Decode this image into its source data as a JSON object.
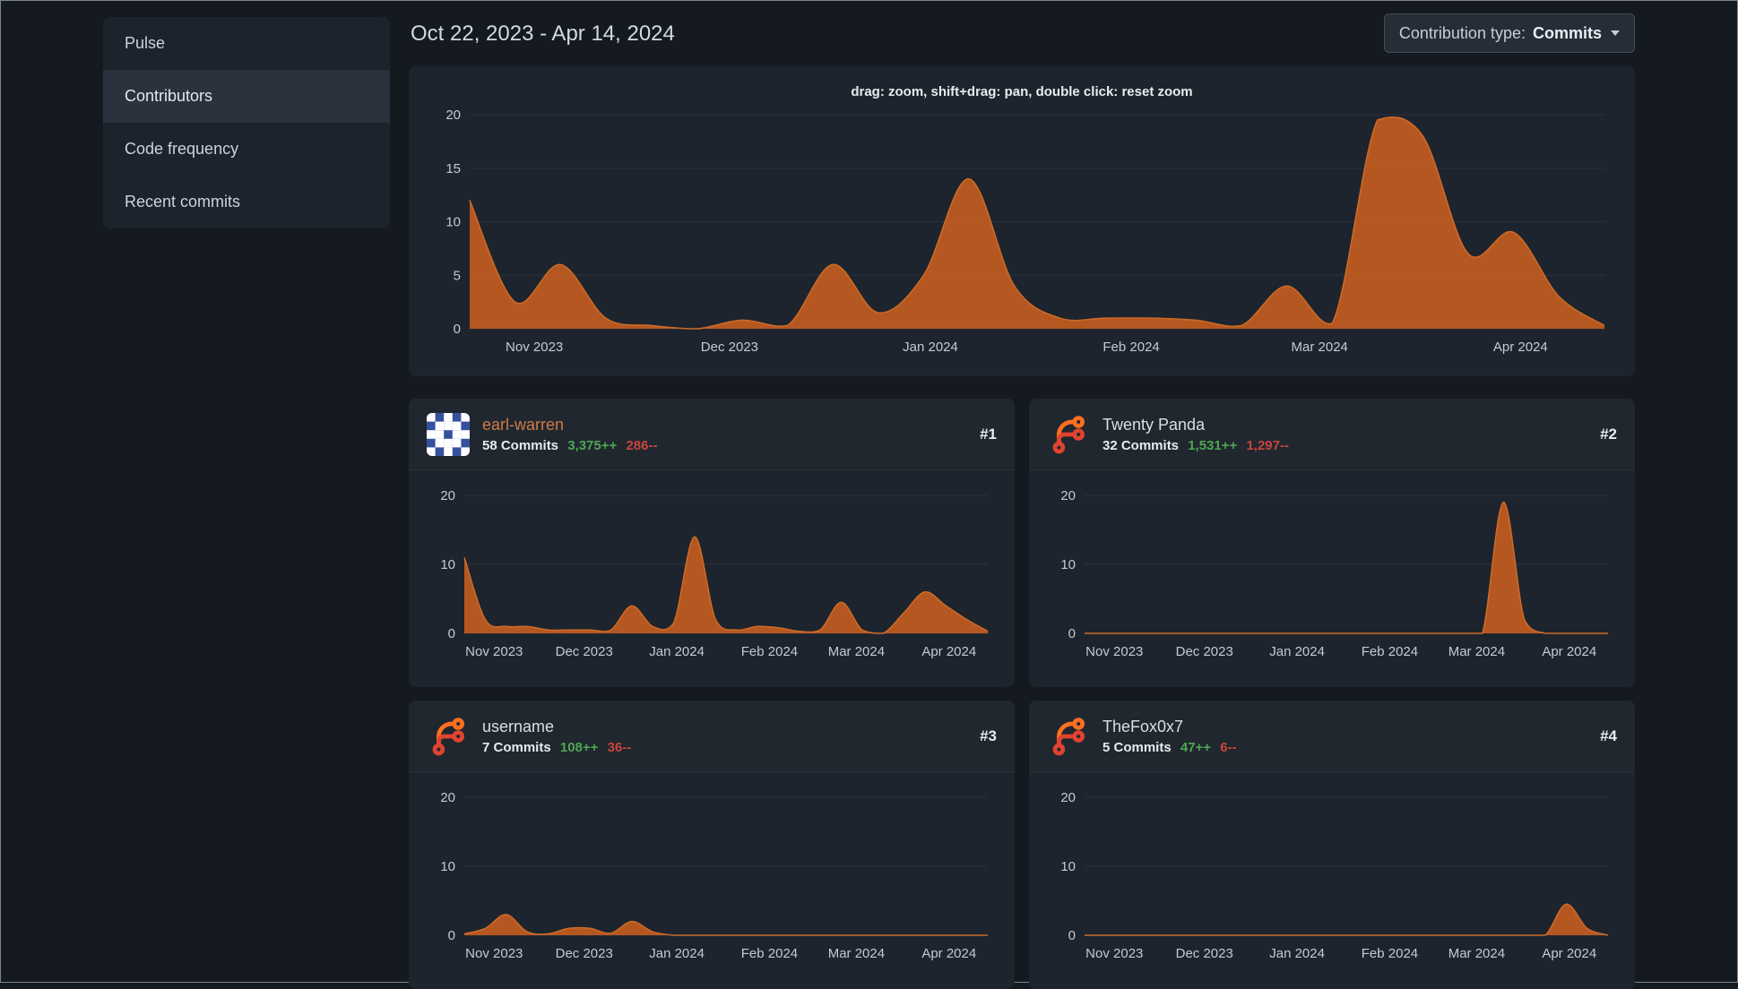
{
  "page": {
    "date_range": "Oct 22, 2023 - Apr 14, 2024"
  },
  "sidebar": {
    "items": [
      {
        "label": "Pulse",
        "active": false
      },
      {
        "label": "Contributors",
        "active": true
      },
      {
        "label": "Code frequency",
        "active": false
      },
      {
        "label": "Recent commits",
        "active": false
      }
    ]
  },
  "toolbar": {
    "contribution_type_label": "Contribution type:",
    "contribution_type_value": "Commits",
    "chevron_icon": "chevron-down-icon"
  },
  "main_chart": {
    "hint": "drag: zoom, shift+drag: pan, double click: reset zoom"
  },
  "contributors": [
    {
      "rank": "#1",
      "name": "earl-warren",
      "commits": "58 Commits",
      "additions": "3,375++",
      "deletions": "286--",
      "avatar": "identicon"
    },
    {
      "rank": "#2",
      "name": "Twenty Panda",
      "commits": "32 Commits",
      "additions": "1,531++",
      "deletions": "1,297--",
      "avatar": "forgejo-logo"
    },
    {
      "rank": "#3",
      "name": "username",
      "commits": "7 Commits",
      "additions": "108++",
      "deletions": "36--",
      "avatar": "forgejo-logo"
    },
    {
      "rank": "#4",
      "name": "TheFox0x7",
      "commits": "5 Commits",
      "additions": "47++",
      "deletions": "6--",
      "avatar": "forgejo-logo"
    }
  ],
  "chart_data": {
    "type": "area",
    "x_axis": {
      "range": [
        "Oct 22, 2023",
        "Apr 14, 2024"
      ],
      "unit": "week",
      "ticks": [
        {
          "frac": 0.057,
          "label": "Nov 2023"
        },
        {
          "frac": 0.229,
          "label": "Dec 2023"
        },
        {
          "frac": 0.406,
          "label": "Jan 2024"
        },
        {
          "frac": 0.583,
          "label": "Feb 2024"
        },
        {
          "frac": 0.749,
          "label": "Mar 2024"
        },
        {
          "frac": 0.926,
          "label": "Apr 2024"
        }
      ]
    },
    "area_color": "#bb5a20",
    "line_color": "#cf6c28",
    "grid_color": "#2b323c",
    "axis_label_color": "#c3cad3",
    "charts": [
      {
        "name": "all-contributions-commits-per-week",
        "ylim": [
          0,
          20
        ],
        "yticks": [
          0,
          5,
          10,
          15,
          20
        ],
        "values": [
          12,
          2.5,
          6,
          1,
          0.3,
          0,
          0.8,
          0.3,
          6,
          1.5,
          5,
          14,
          4,
          1,
          1,
          1,
          0.8,
          0.3,
          4,
          0.5,
          19.5,
          18,
          7,
          9,
          3,
          0.3
        ]
      },
      {
        "name": "earl-warren-commits-per-week",
        "ylim": [
          0,
          20
        ],
        "yticks": [
          0,
          10,
          20
        ],
        "values": [
          11,
          2,
          1,
          1,
          0.5,
          0.5,
          0.5,
          0.5,
          4,
          1,
          1.5,
          14,
          2,
          0.5,
          1,
          0.8,
          0.3,
          0.5,
          4.5,
          0.5,
          0,
          3,
          6,
          4,
          2,
          0.3
        ]
      },
      {
        "name": "twenty-panda-commits-per-week",
        "ylim": [
          0,
          20
        ],
        "yticks": [
          0,
          10,
          20
        ],
        "values": [
          0,
          0,
          0,
          0,
          0,
          0,
          0,
          0,
          0,
          0,
          0,
          0,
          0,
          0,
          0,
          0,
          0,
          0,
          0,
          0,
          19,
          2,
          0,
          0,
          0,
          0
        ]
      },
      {
        "name": "username-commits-per-week",
        "ylim": [
          0,
          20
        ],
        "yticks": [
          0,
          10,
          20
        ],
        "values": [
          0.2,
          1,
          3,
          0.5,
          0.2,
          1,
          1,
          0.3,
          2,
          0.5,
          0,
          0,
          0,
          0,
          0,
          0,
          0,
          0,
          0,
          0,
          0,
          0,
          0,
          0,
          0,
          0
        ]
      },
      {
        "name": "thefox0x7-commits-per-week",
        "ylim": [
          0,
          20
        ],
        "yticks": [
          0,
          10,
          20
        ],
        "values": [
          0,
          0,
          0,
          0,
          0,
          0,
          0,
          0,
          0,
          0,
          0,
          0,
          0,
          0,
          0,
          0,
          0,
          0,
          0,
          0,
          0,
          0,
          0,
          4.5,
          1,
          0
        ]
      }
    ]
  }
}
